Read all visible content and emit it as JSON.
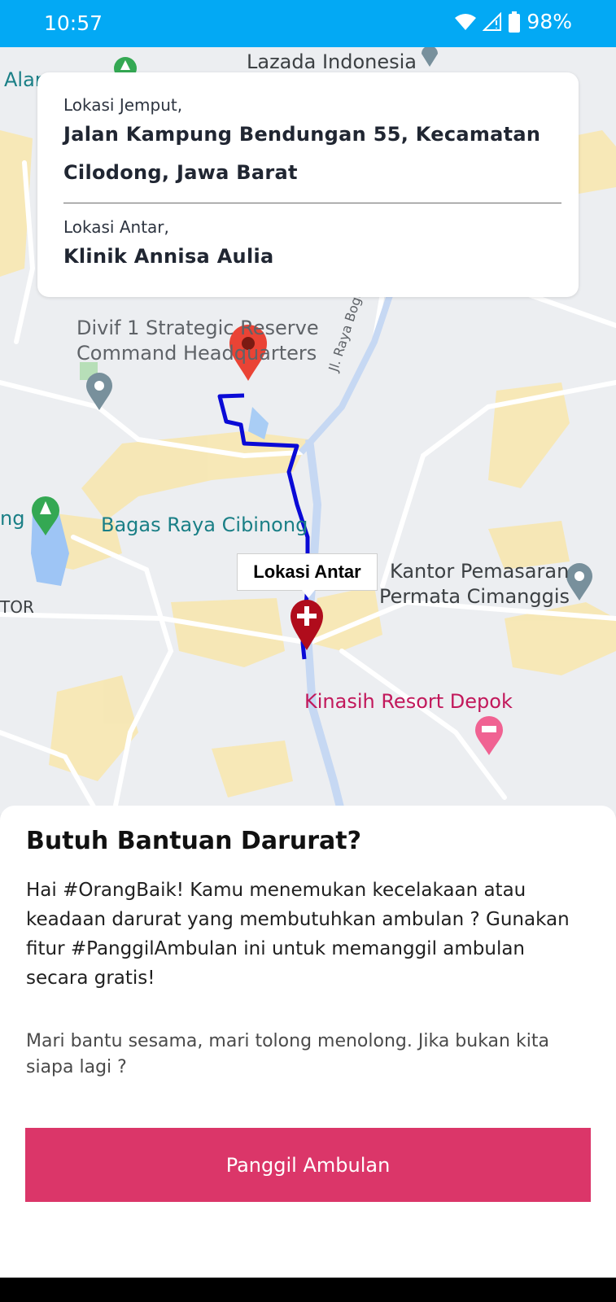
{
  "status_bar": {
    "time": "10:57",
    "battery": "98%",
    "icons": [
      "wifi-icon",
      "cell-signal-icon",
      "battery-icon"
    ]
  },
  "route_card": {
    "pickup_label": "Lokasi Jemput,",
    "pickup_address_line1": "Jalan Kampung Bendungan 55, Kecamatan",
    "pickup_address_line2": "Cilodong, Jawa Barat",
    "dropoff_label": "Lokasi Antar,",
    "dropoff_address": "Klinik Annisa Aulia"
  },
  "map": {
    "labels": {
      "lazada": "Lazada Indonesia",
      "alar": "Alar",
      "divif_line1": "Divif 1 Strategic Reserve",
      "divif_line2": "Command Headquarters",
      "jl_raya_bogor": "Jl. Raya Bogor",
      "ng": "ng",
      "bagas": "Bagas Raya Cibinong",
      "kantor_line1": "Kantor Pemasaran",
      "kantor_line2": "Permata Cimanggis",
      "tor": "TOR",
      "kinasih": "Kinasih Resort Depok"
    },
    "marker_tooltip": "Lokasi Antar",
    "colors": {
      "route": "#0a0ad6",
      "pickup_marker": "#ea4335",
      "dropoff_marker": "#b00c1c",
      "teal_label": "#1a7f86",
      "pink_label": "#c2185b"
    }
  },
  "sheet": {
    "title": "Butuh Bantuan Darurat?",
    "body": "Hai #OrangBaik! Kamu menemukan kecelakaan atau keadaan darurat yang membutuhkan ambulan ? Gunakan fitur #PanggilAmbulan ini untuk memanggil ambulan secara gratis!",
    "sub": "Mari bantu sesama, mari tolong menolong. Jika bukan kita siapa lagi ?",
    "button_label": "Panggil Ambulan",
    "button_color": "#db3669"
  }
}
